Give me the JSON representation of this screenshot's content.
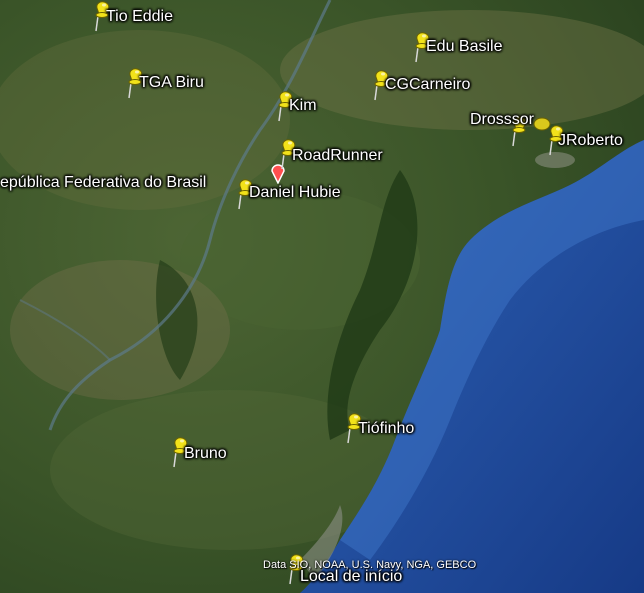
{
  "colors": {
    "ocean_deep": "#1b3f8a",
    "ocean_shallow": "#2f63b7",
    "land_dark": "#253c1b",
    "land_mid": "#3e5a2a",
    "land_light": "#6f7a4c",
    "pin_yellow": "#f2e21a",
    "pin_outline": "#6b6200"
  },
  "region_label": "epública Federativa do Brasil",
  "attribution": "Data SIO, NOAA, U.S. Navy, NGA, GEBCO",
  "placemarks": [
    {
      "label": "Tio Eddie",
      "icon": "yellow-pushpin-icon"
    },
    {
      "label": "Edu Basile",
      "icon": "yellow-pushpin-icon"
    },
    {
      "label": "TGA Biru",
      "icon": "yellow-pushpin-icon"
    },
    {
      "label": "CGCarneiro",
      "icon": "yellow-pushpin-icon"
    },
    {
      "label": "Kim",
      "icon": "yellow-pushpin-icon"
    },
    {
      "label": "Drosssor",
      "icon": "yellow-pushpin-icon"
    },
    {
      "label": "JRoberto",
      "icon": "yellow-pushpin-icon"
    },
    {
      "label": "RoadRunner",
      "icon": "yellow-pushpin-icon"
    },
    {
      "label": "Daniel Hubie",
      "icon": "yellow-pushpin-icon"
    },
    {
      "label": "Tiófinho",
      "icon": "yellow-pushpin-icon"
    },
    {
      "label": "Bruno",
      "icon": "yellow-pushpin-icon"
    },
    {
      "label": "Local de início",
      "icon": "yellow-pushpin-icon"
    }
  ]
}
